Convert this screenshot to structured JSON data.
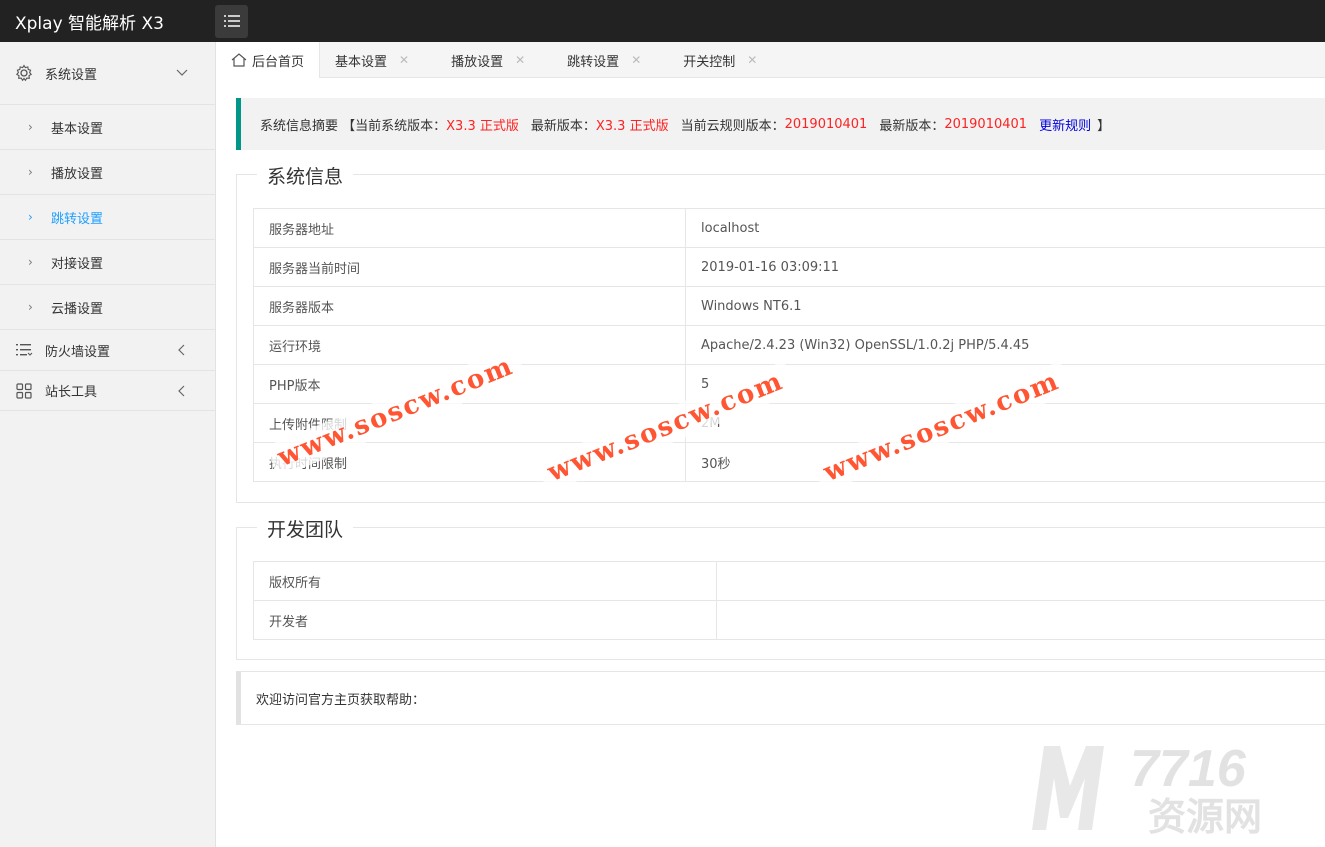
{
  "app": {
    "title": "Xplay 智能解析 X3"
  },
  "sidebar": {
    "groups": [
      {
        "label": "系统设置",
        "icon": "gear-icon"
      },
      {
        "label": "防火墙设置",
        "icon": "list-icon"
      },
      {
        "label": "站长工具",
        "icon": "grid-icon"
      }
    ],
    "sub_items": [
      {
        "label": "基本设置"
      },
      {
        "label": "播放设置"
      },
      {
        "label": "跳转设置"
      },
      {
        "label": "对接设置"
      },
      {
        "label": "云播设置"
      }
    ],
    "active_sub_item": "跳转设置"
  },
  "tabs": [
    {
      "label": "后台首页",
      "closable": false
    },
    {
      "label": "基本设置",
      "closable": true
    },
    {
      "label": "播放设置",
      "closable": true
    },
    {
      "label": "跳转设置",
      "closable": true
    },
    {
      "label": "开关控制",
      "closable": true
    }
  ],
  "summary": {
    "prefix": "系统信息摘要 【当前系统版本：",
    "current_version": "X3.3 正式版",
    "latest_label": "最新版本：",
    "latest_version": "X3.3 正式版",
    "rule_label": "当前云规则版本：",
    "rule_version": "2019010401",
    "latest_rule_label": "最新版本：",
    "latest_rule_version": "2019010401",
    "update_link": "更新规则",
    "suffix": "】"
  },
  "system_info": {
    "title": "系统信息",
    "rows": [
      {
        "key": "服务器地址",
        "value": "localhost"
      },
      {
        "key": "服务器当前时间",
        "value": "2019-01-16 03:09:11"
      },
      {
        "key": "服务器版本",
        "value": "Windows NT6.1"
      },
      {
        "key": "运行环境",
        "value": "Apache/2.4.23 (Win32) OpenSSL/1.0.2j PHP/5.4.45"
      },
      {
        "key": "PHP版本",
        "value": "5"
      },
      {
        "key": "上传附件限制",
        "value": "2M"
      },
      {
        "key": "执行时间限制",
        "value": "30秒"
      }
    ]
  },
  "dev_team": {
    "title": "开发团队",
    "rows": [
      {
        "key": "版权所有",
        "value": ""
      },
      {
        "key": "开发者",
        "value": ""
      }
    ]
  },
  "welcome": {
    "text": "欢迎访问官方主页获取帮助："
  },
  "watermarks": [
    "www.soscw.com",
    "www.soscw.com",
    "www.soscw.com"
  ],
  "brand_watermark": {
    "number": "7716",
    "text": "资源网"
  },
  "colors": {
    "accent": "#009688",
    "active": "#1e9fff",
    "highlight": "#ff2222",
    "link": "#0000dd"
  }
}
